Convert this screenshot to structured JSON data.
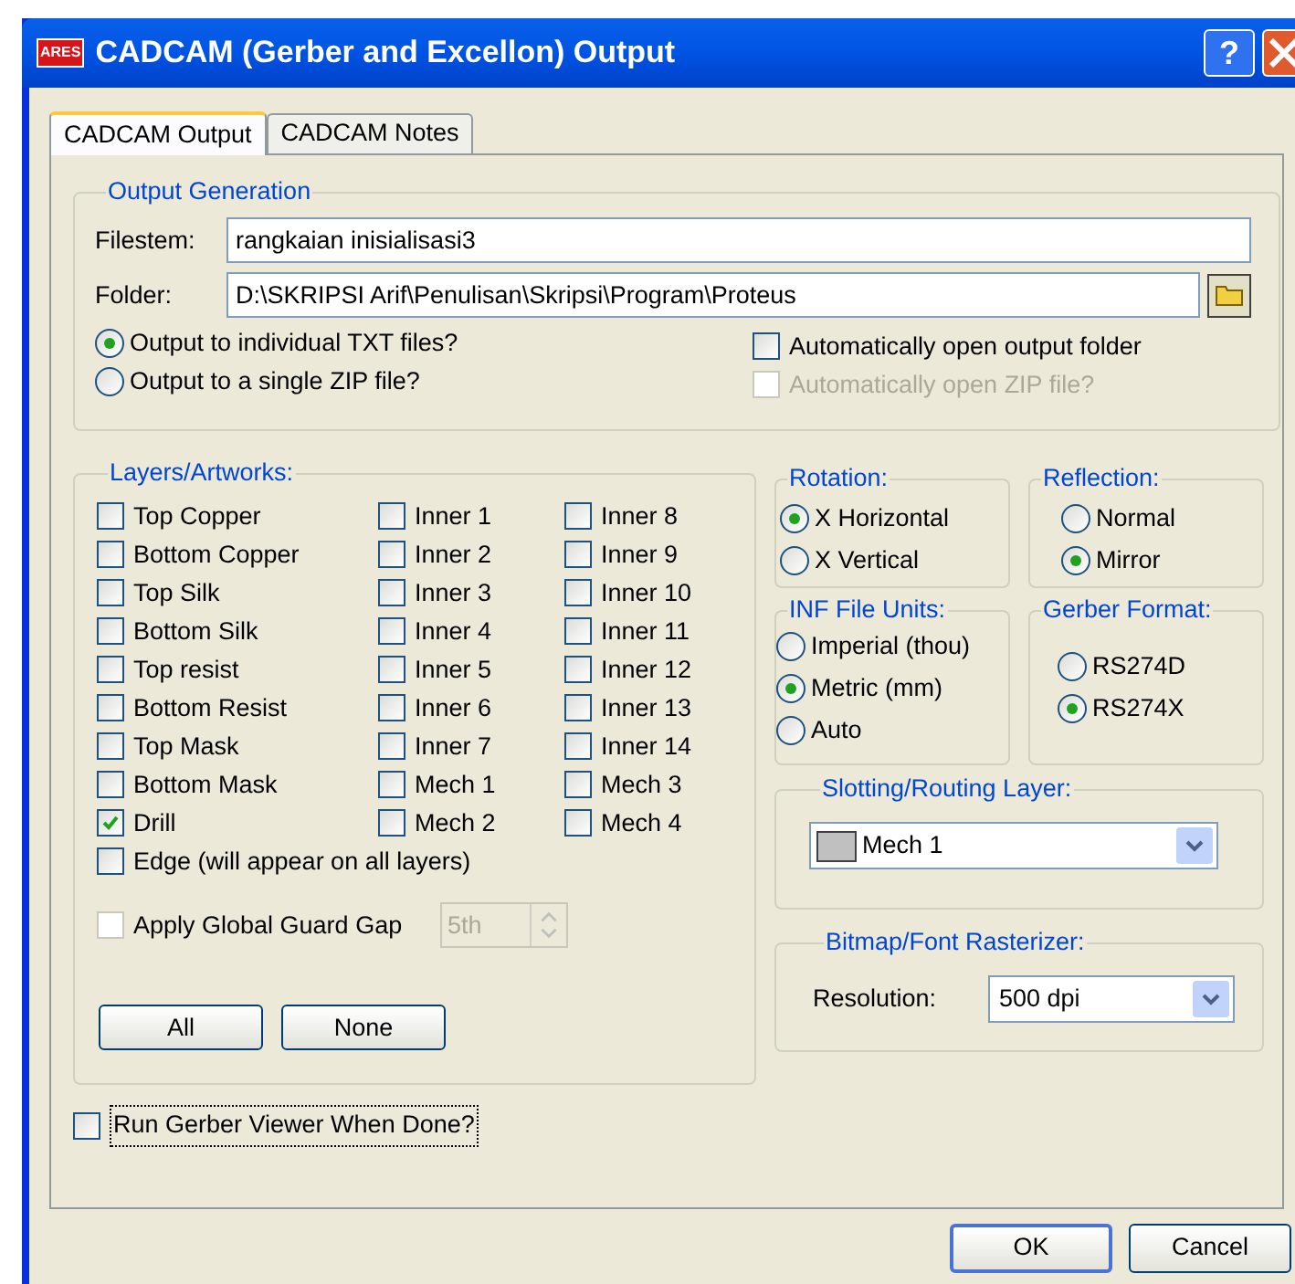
{
  "window": {
    "logo": "ARES",
    "title": "CADCAM (Gerber and Excellon) Output",
    "help_button": "?"
  },
  "tabs": [
    {
      "label": "CADCAM Output",
      "selected": true
    },
    {
      "label": "CADCAM Notes",
      "selected": false
    }
  ],
  "output_generation": {
    "title": "Output Generation",
    "filestem": {
      "label": "Filestem:",
      "value": "rangkaian inisialisasi3"
    },
    "folder": {
      "label": "Folder:",
      "value": "D:\\SKRIPSI Arif\\Penulisan\\Skripsi\\Program\\Proteus"
    },
    "output_mode": [
      {
        "label": "Output to individual TXT files?",
        "selected": true
      },
      {
        "label": "Output to a single ZIP file?",
        "selected": false
      }
    ],
    "auto_open": [
      {
        "label": "Automatically open output folder",
        "checked": false,
        "disabled": false
      },
      {
        "label": "Automatically open ZIP file?",
        "checked": false,
        "disabled": true
      }
    ]
  },
  "layers": {
    "title": "Layers/Artworks:",
    "columns": [
      [
        {
          "label": "Top Copper",
          "checked": false
        },
        {
          "label": "Bottom Copper",
          "checked": false
        },
        {
          "label": "Top Silk",
          "checked": false
        },
        {
          "label": "Bottom Silk",
          "checked": false
        },
        {
          "label": "Top resist",
          "checked": false
        },
        {
          "label": "Bottom Resist",
          "checked": false
        },
        {
          "label": "Top Mask",
          "checked": false
        },
        {
          "label": "Bottom Mask",
          "checked": false
        },
        {
          "label": "Drill",
          "checked": true
        }
      ],
      [
        {
          "label": "Inner 1",
          "checked": false
        },
        {
          "label": "Inner 2",
          "checked": false
        },
        {
          "label": "Inner 3",
          "checked": false
        },
        {
          "label": "Inner 4",
          "checked": false
        },
        {
          "label": "Inner 5",
          "checked": false
        },
        {
          "label": "Inner 6",
          "checked": false
        },
        {
          "label": "Inner 7",
          "checked": false
        },
        {
          "label": "Mech 1",
          "checked": false
        },
        {
          "label": "Mech 2",
          "checked": false
        }
      ],
      [
        {
          "label": "Inner 8",
          "checked": false
        },
        {
          "label": "Inner 9",
          "checked": false
        },
        {
          "label": "Inner 10",
          "checked": false
        },
        {
          "label": "Inner 11",
          "checked": false
        },
        {
          "label": "Inner 12",
          "checked": false
        },
        {
          "label": "Inner 13",
          "checked": false
        },
        {
          "label": "Inner 14",
          "checked": false
        },
        {
          "label": "Mech 3",
          "checked": false
        },
        {
          "label": "Mech 4",
          "checked": false
        }
      ]
    ],
    "edge": {
      "label": "Edge (will appear on all layers)",
      "checked": false
    },
    "guard_gap": {
      "label": "Apply Global Guard Gap",
      "checked": false,
      "value": "5th",
      "disabled": true
    },
    "buttons": [
      "All",
      "None"
    ]
  },
  "rotation": {
    "title": "Rotation:",
    "options": [
      {
        "label": "X Horizontal",
        "selected": true
      },
      {
        "label": "X Vertical",
        "selected": false
      }
    ]
  },
  "reflection": {
    "title": "Reflection:",
    "options": [
      {
        "label": "Normal",
        "selected": false
      },
      {
        "label": "Mirror",
        "selected": true
      }
    ]
  },
  "inf_file_units": {
    "title": "INF File Units:",
    "options": [
      {
        "label": "Imperial (thou)",
        "selected": false
      },
      {
        "label": "Metric (mm)",
        "selected": true
      },
      {
        "label": "Auto",
        "selected": false
      }
    ]
  },
  "gerber_format": {
    "title": "Gerber Format:",
    "options": [
      {
        "label": "RS274D",
        "selected": false
      },
      {
        "label": "RS274X",
        "selected": true
      }
    ]
  },
  "slotting_layer": {
    "title": "Slotting/Routing Layer:",
    "value": "Mech 1"
  },
  "rasterizer": {
    "title": "Bitmap/Font Rasterizer:",
    "label": "Resolution:",
    "value": "500 dpi"
  },
  "run_viewer": {
    "label": "Run Gerber Viewer When Done?",
    "checked": false
  },
  "dialog_buttons": [
    "OK",
    "Cancel"
  ]
}
